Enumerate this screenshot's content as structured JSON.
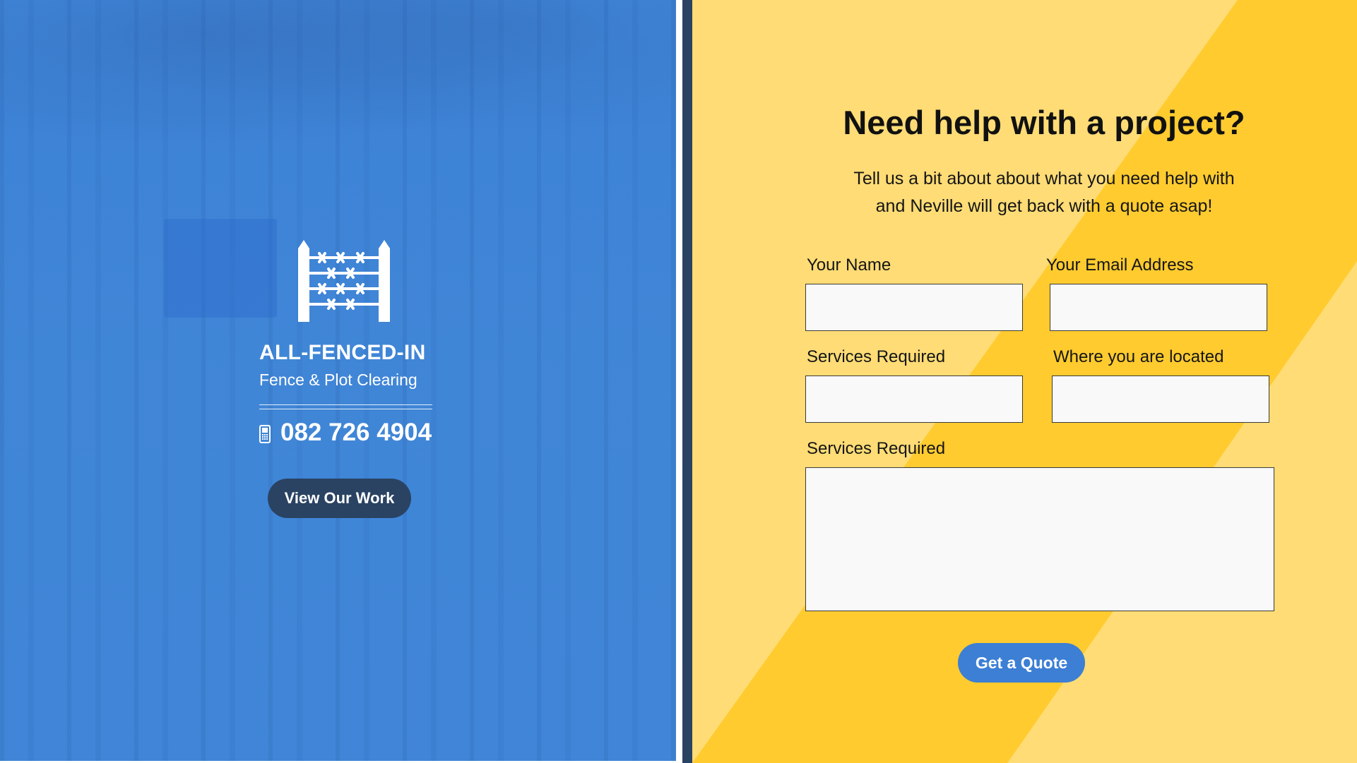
{
  "brand": {
    "name": "ALL-FENCED-IN",
    "tagline": "Fence & Plot Clearing",
    "phone": "082 726 4904",
    "view_work_label": "View Our Work"
  },
  "form": {
    "heading": "Need help with a project?",
    "intro_line1": "Tell us a bit about about what you need help with",
    "intro_line2": "and Neville will get back with a quote asap!",
    "fields": {
      "name_label": "Your Name",
      "name_value": "",
      "email_label": "Your Email Address",
      "email_value": "",
      "services_label": "Services Required",
      "services_value": "",
      "location_label": "Where you are located",
      "location_value": "",
      "details_label": "Services Required",
      "details_value": ""
    },
    "submit_label": "Get a Quote"
  },
  "colors": {
    "left_panel_blue": "#3e84d6",
    "navy": "#2a4363",
    "yellow_light": "#ffdc75",
    "yellow_strong": "#ffcb2f",
    "button_blue": "#3c7fd4"
  }
}
